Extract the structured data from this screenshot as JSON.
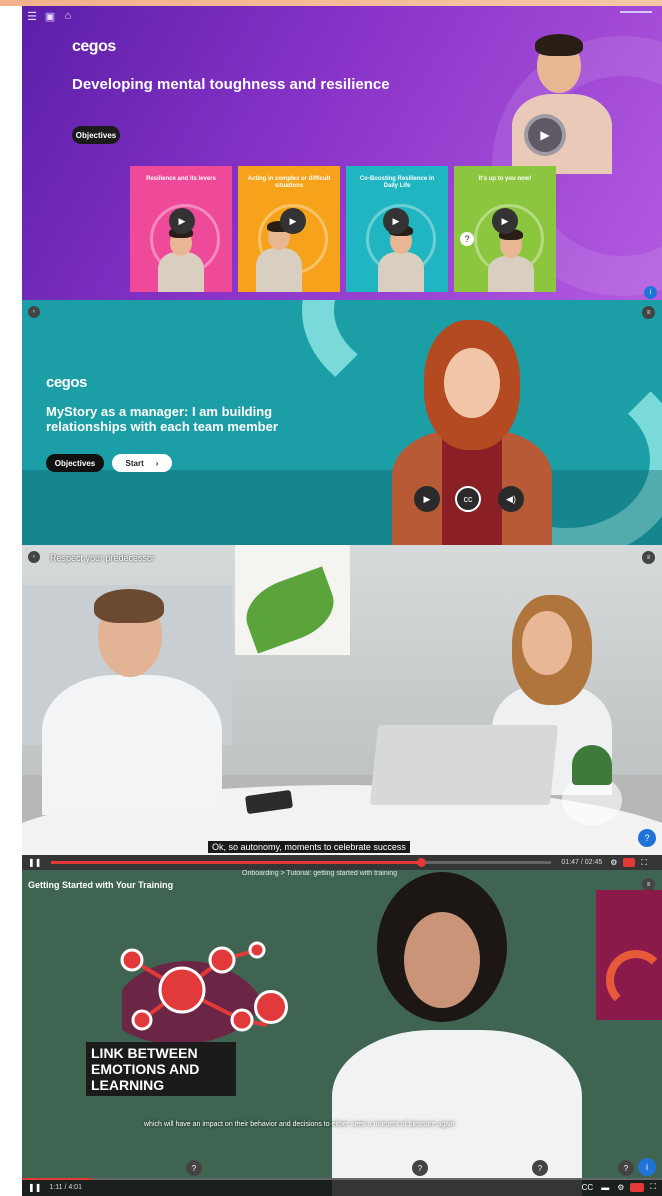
{
  "panel1": {
    "brand": "cegos",
    "title": "Developing mental toughness and resilience",
    "objectives_label": "Objectives",
    "nav_icons": [
      "menu-icon",
      "grid-icon",
      "home-icon"
    ],
    "cards": [
      {
        "title": "Resilience and its levers",
        "color": "#ef4a9a"
      },
      {
        "title": "Acting in complex or difficult situations",
        "color": "#f6a21a"
      },
      {
        "title": "Co-Boosting Resilience in Daily Life",
        "color": "#1fb5c1"
      },
      {
        "title": "It's up to you now!",
        "color": "#8cc63f"
      }
    ]
  },
  "panel2": {
    "brand": "cegos",
    "title": "MyStory as a manager: I am building relationships with each team member",
    "objectives_label": "Objectives",
    "start_label": "Start"
  },
  "panel3": {
    "header": "Respect your predecessor",
    "caption": "Ok, so autonomy, moments to celebrate success",
    "time": "01:47 / 02:45"
  },
  "panel4": {
    "header": "Getting Started with Your Training",
    "subheader": "Onboarding > Tutorial: getting started with training",
    "overlay_text": "LINK BETWEEN EMOTIONS AND LEARNING",
    "caption": "which will have an impact on their behavior and decisions to either seek a moment of pleasure again",
    "time": "1:11 / 4:01"
  }
}
